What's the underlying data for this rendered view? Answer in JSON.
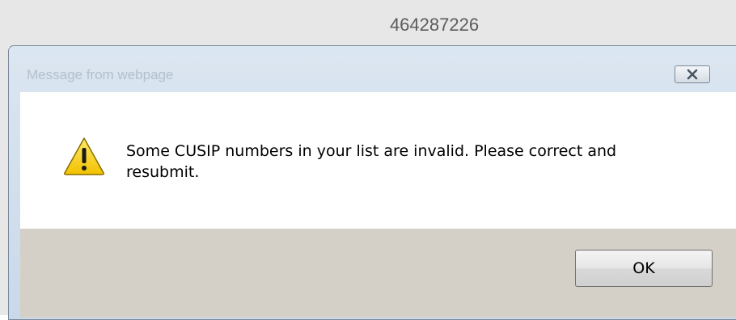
{
  "background": {
    "field_value": "464287226"
  },
  "dialog": {
    "title": "Message from webpage",
    "message": "Some CUSIP numbers in your list are invalid. Please correct and resubmit.",
    "ok_label": "OK",
    "icons": {
      "close": "close-icon",
      "warning": "warning-icon"
    },
    "colors": {
      "title_bar": "#c9d9ea",
      "footer": "#d4d0c8",
      "warning_yellow": "#f7d21a"
    }
  }
}
